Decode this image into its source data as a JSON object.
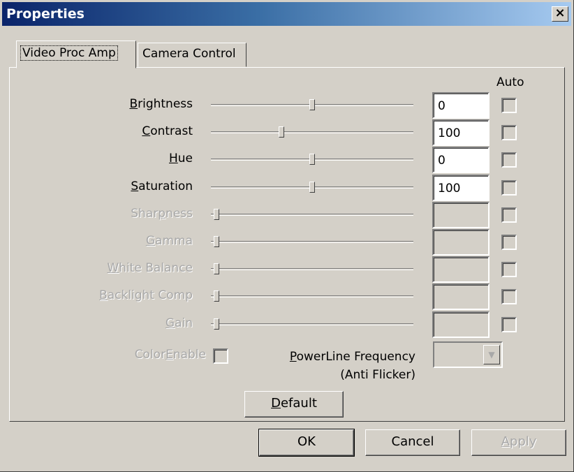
{
  "window": {
    "title": "Properties",
    "close_glyph": "×"
  },
  "tabs": [
    {
      "label": "Video Proc Amp",
      "active": true
    },
    {
      "label": "Camera Control",
      "active": false
    }
  ],
  "auto_header": "Auto",
  "rows": [
    {
      "id": "brightness",
      "label": "Brightness",
      "accesskey": "B",
      "value": "0",
      "level": 0.5,
      "enabled": true
    },
    {
      "id": "contrast",
      "label": "Contrast",
      "accesskey": "C",
      "value": "100",
      "level": 0.34,
      "enabled": true
    },
    {
      "id": "hue",
      "label": "Hue",
      "accesskey": "H",
      "value": "0",
      "level": 0.5,
      "enabled": true
    },
    {
      "id": "saturation",
      "label": "Saturation",
      "accesskey": "S",
      "value": "100",
      "level": 0.5,
      "enabled": true
    },
    {
      "id": "sharpness",
      "label": "Sharpness",
      "accesskey": "p",
      "value": "",
      "level": 0.0,
      "enabled": false
    },
    {
      "id": "gamma",
      "label": "Gamma",
      "accesskey": "G",
      "value": "",
      "level": 0.0,
      "enabled": false
    },
    {
      "id": "white-balance",
      "label": "White Balance",
      "accesskey": "W",
      "value": "",
      "level": 0.0,
      "enabled": false
    },
    {
      "id": "backlight-comp",
      "label": "Backlight Comp",
      "accesskey": "B",
      "value": "",
      "level": 0.0,
      "enabled": false
    },
    {
      "id": "gain",
      "label": "Gain",
      "accesskey": "G",
      "value": "",
      "level": 0.0,
      "enabled": false
    }
  ],
  "color_enable": {
    "label": "ColorEnable",
    "accesskey": "E"
  },
  "powerline": {
    "line1": "PowerLine Frequency",
    "line2": "(Anti Flicker)",
    "accesskey": "P",
    "value": ""
  },
  "buttons": {
    "default": "Default",
    "ok": "OK",
    "cancel": "Cancel",
    "apply": "Apply"
  },
  "icons": {
    "close": "close-icon",
    "dropdown": "chevron-down-icon"
  }
}
